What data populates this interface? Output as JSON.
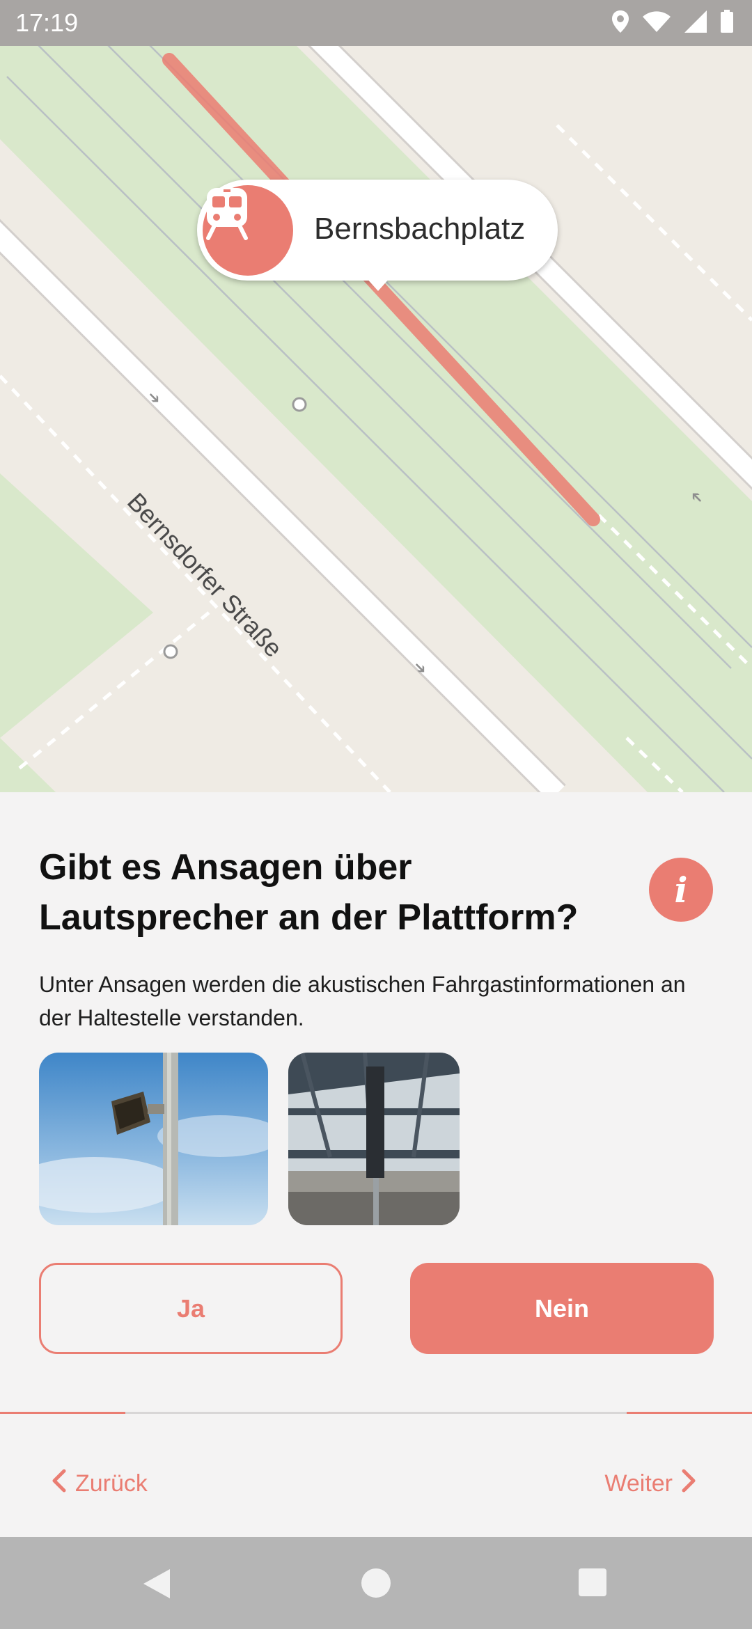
{
  "status_bar": {
    "time": "17:19",
    "icons": [
      "location-icon",
      "wifi-icon",
      "signal-icon",
      "battery-icon"
    ]
  },
  "map": {
    "street_label": "Bernsdorfer Straße",
    "stop_name": "Bernsbachplatz",
    "stop_icon": "tram-icon",
    "colors": {
      "accent": "#ea7d72",
      "green": "#d9e8cb",
      "road": "#ffffff"
    }
  },
  "question": {
    "title": "Gibt es Ansagen über Lautsprecher an der Plattform?",
    "description": "Unter Ansagen werden die akustischen Fahrgastinformationen an der Haltestelle verstanden.",
    "info_icon": "info-icon",
    "info_label": "i"
  },
  "images": [
    {
      "name": "loudspeaker-on-pole-photo"
    },
    {
      "name": "platform-roof-speaker-photo"
    }
  ],
  "answers": {
    "yes_label": "Ja",
    "no_label": "Nein",
    "selected": "Nein"
  },
  "navigation": {
    "back_label": "Zurück",
    "next_label": "Weiter",
    "progress_fraction": 0.11
  },
  "system_nav": {
    "icons": [
      "back-triangle-icon",
      "home-circle-icon",
      "recents-square-icon"
    ]
  }
}
